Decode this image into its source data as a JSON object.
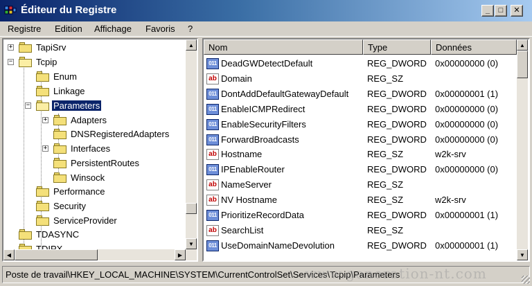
{
  "window": {
    "title": "Éditeur du Registre",
    "controls": {
      "minimize": "_",
      "maximize": "□",
      "close": "✕"
    }
  },
  "menu": [
    "Registre",
    "Edition",
    "Affichage",
    "Favoris",
    "?"
  ],
  "tree": {
    "items": [
      {
        "label": "TapiSrv",
        "expander": "+"
      },
      {
        "label": "Tcpip",
        "expander": "−"
      },
      {
        "label": "Enum",
        "expander": ""
      },
      {
        "label": "Linkage",
        "expander": ""
      },
      {
        "label": "Parameters",
        "expander": "−",
        "selected": true
      },
      {
        "label": "Adapters",
        "expander": "+"
      },
      {
        "label": "DNSRegisteredAdapters",
        "expander": ""
      },
      {
        "label": "Interfaces",
        "expander": "+"
      },
      {
        "label": "PersistentRoutes",
        "expander": ""
      },
      {
        "label": "Winsock",
        "expander": ""
      },
      {
        "label": "Performance",
        "expander": ""
      },
      {
        "label": "Security",
        "expander": ""
      },
      {
        "label": "ServiceProvider",
        "expander": ""
      },
      {
        "label": "TDASYNC",
        "expander": ""
      },
      {
        "label": "TDIPX",
        "expander": ""
      }
    ]
  },
  "list": {
    "columns": [
      "Nom",
      "Type",
      "Données"
    ],
    "rows": [
      {
        "icon": "dword-icon",
        "name": "DeadGWDetectDefault",
        "type": "REG_DWORD",
        "data": "0x00000000 (0)"
      },
      {
        "icon": "string-icon",
        "name": "Domain",
        "type": "REG_SZ",
        "data": ""
      },
      {
        "icon": "dword-icon",
        "name": "DontAddDefaultGatewayDefault",
        "type": "REG_DWORD",
        "data": "0x00000001 (1)"
      },
      {
        "icon": "dword-icon",
        "name": "EnableICMPRedirect",
        "type": "REG_DWORD",
        "data": "0x00000000 (0)"
      },
      {
        "icon": "dword-icon",
        "name": "EnableSecurityFilters",
        "type": "REG_DWORD",
        "data": "0x00000000 (0)"
      },
      {
        "icon": "dword-icon",
        "name": "ForwardBroadcasts",
        "type": "REG_DWORD",
        "data": "0x00000000 (0)"
      },
      {
        "icon": "string-icon",
        "name": "Hostname",
        "type": "REG_SZ",
        "data": "w2k-srv"
      },
      {
        "icon": "dword-icon",
        "name": "IPEnableRouter",
        "type": "REG_DWORD",
        "data": "0x00000000 (0)"
      },
      {
        "icon": "string-icon",
        "name": "NameServer",
        "type": "REG_SZ",
        "data": ""
      },
      {
        "icon": "string-icon",
        "name": "NV Hostname",
        "type": "REG_SZ",
        "data": "w2k-srv"
      },
      {
        "icon": "dword-icon",
        "name": "PrioritizeRecordData",
        "type": "REG_DWORD",
        "data": "0x00000001 (1)"
      },
      {
        "icon": "string-icon",
        "name": "SearchList",
        "type": "REG_SZ",
        "data": ""
      },
      {
        "icon": "dword-icon",
        "name": "UseDomainNameDevolution",
        "type": "REG_DWORD",
        "data": "0x00000001 (1)"
      }
    ]
  },
  "status": {
    "path": "Poste de travail\\HKEY_LOCAL_MACHINE\\SYSTEM\\CurrentControlSet\\Services\\Tcpip\\Parameters",
    "watermark": "www.generation-nt.com"
  },
  "icons": {
    "sz": "ab",
    "dword": "011"
  }
}
